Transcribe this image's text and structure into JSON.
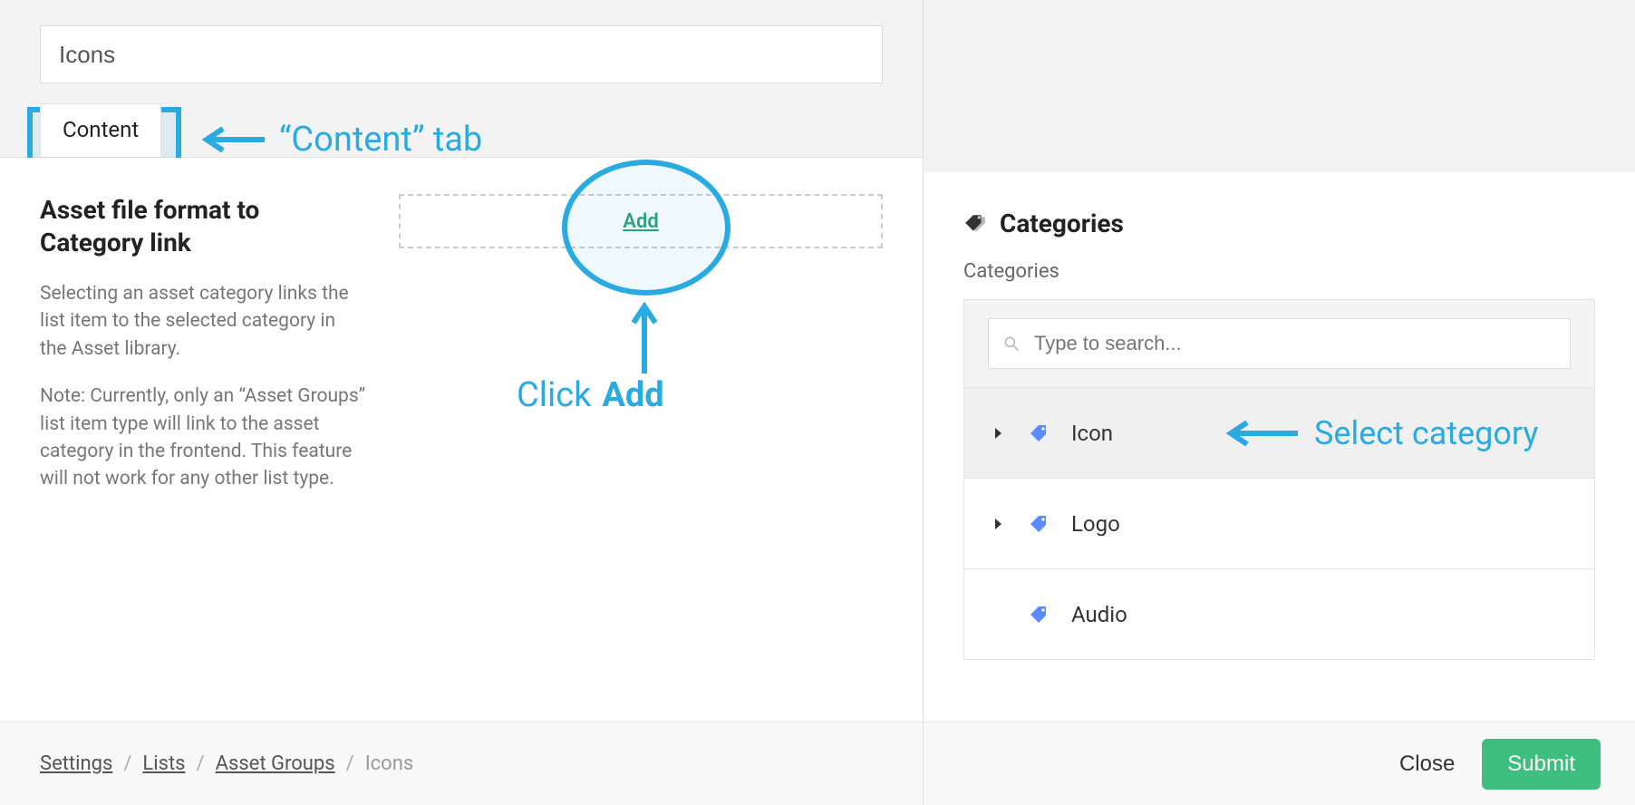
{
  "left": {
    "title_value": "Icons",
    "tab_content_label": "Content",
    "annot_content_tab": "“Content” tab",
    "section_heading": "Asset file format to Category link",
    "section_p1": "Selecting an asset category links the list item to the selected category in the Asset library.",
    "section_p2": "Note: Currently, only an “Asset Groups” list item type will link to the asset category in the frontend. This feature will not work for any other list type.",
    "add_label": "Add",
    "annot_click_prefix": "Click ",
    "annot_click_bold": "Add"
  },
  "breadcrumb": [
    {
      "label": "Settings",
      "link": true
    },
    {
      "label": "Lists",
      "link": true
    },
    {
      "label": "Asset Groups",
      "link": true
    },
    {
      "label": "Icons",
      "link": false
    }
  ],
  "right": {
    "heading": "Categories",
    "subheading": "Categories",
    "search_placeholder": "Type to search...",
    "items": [
      {
        "label": "Icon",
        "expandable": true,
        "selected": true
      },
      {
        "label": "Logo",
        "expandable": true,
        "selected": false
      },
      {
        "label": "Audio",
        "expandable": false,
        "selected": false
      }
    ],
    "annot_select": "Select category",
    "close_label": "Close",
    "submit_label": "Submit"
  }
}
